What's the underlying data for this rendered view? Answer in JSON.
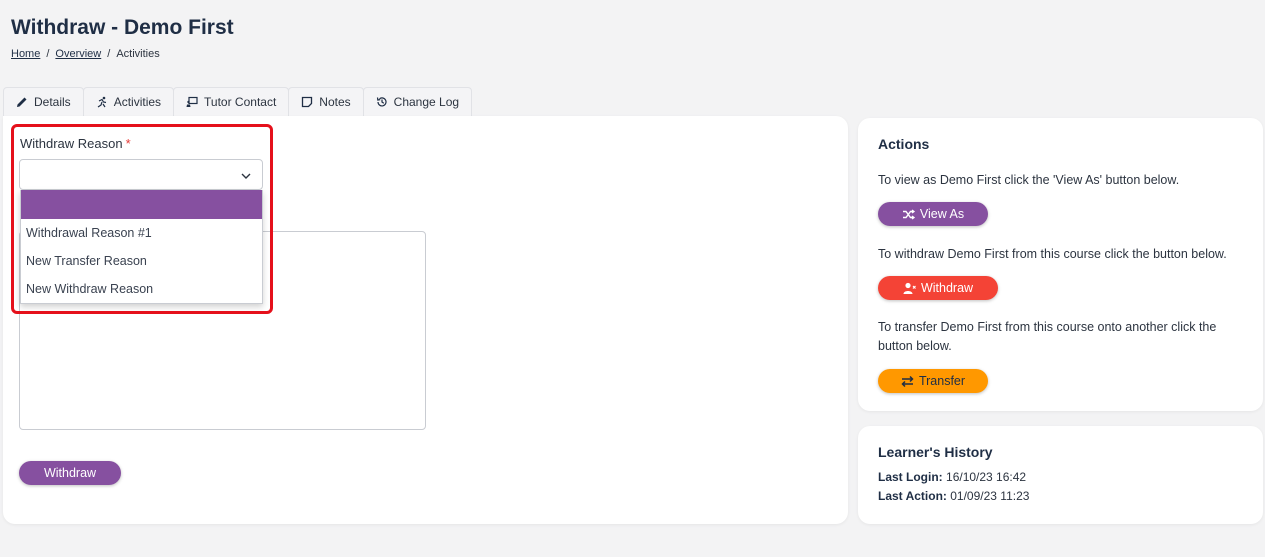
{
  "page": {
    "title": "Withdraw - Demo First",
    "breadcrumb": [
      "Home",
      "Overview",
      "Activities"
    ],
    "breadcrumb_sep": "/"
  },
  "tabs": [
    {
      "label": "Details",
      "icon": "pencil-icon"
    },
    {
      "label": "Activities",
      "icon": "running-icon"
    },
    {
      "label": "Tutor Contact",
      "icon": "chalkboard-icon"
    },
    {
      "label": "Notes",
      "icon": "note-icon"
    },
    {
      "label": "Change Log",
      "icon": "history-icon"
    }
  ],
  "form": {
    "reason_label": "Withdraw Reason",
    "required_mark": "*",
    "reason_value": "",
    "options": [
      "",
      "Withdrawal Reason #1",
      "New Transfer Reason",
      "New Withdraw Reason"
    ],
    "submit_label": "Withdraw"
  },
  "actions": {
    "title": "Actions",
    "view_text": "To view as Demo First click the 'View As' button below.",
    "view_button": "View As",
    "withdraw_text": "To withdraw Demo First from this course click the button below.",
    "withdraw_button": "Withdraw",
    "transfer_text": "To transfer Demo First from this course onto another click the button below.",
    "transfer_button": "Transfer"
  },
  "history": {
    "title": "Learner's History",
    "last_login_label": "Last Login:",
    "last_login_value": "16/10/23 16:42",
    "last_action_label": "Last Action:",
    "last_action_value": "01/09/23 11:23"
  },
  "colors": {
    "primary": "#8650a0",
    "danger": "#f44336",
    "warning": "#ff9800",
    "highlight": "#e5101b"
  }
}
